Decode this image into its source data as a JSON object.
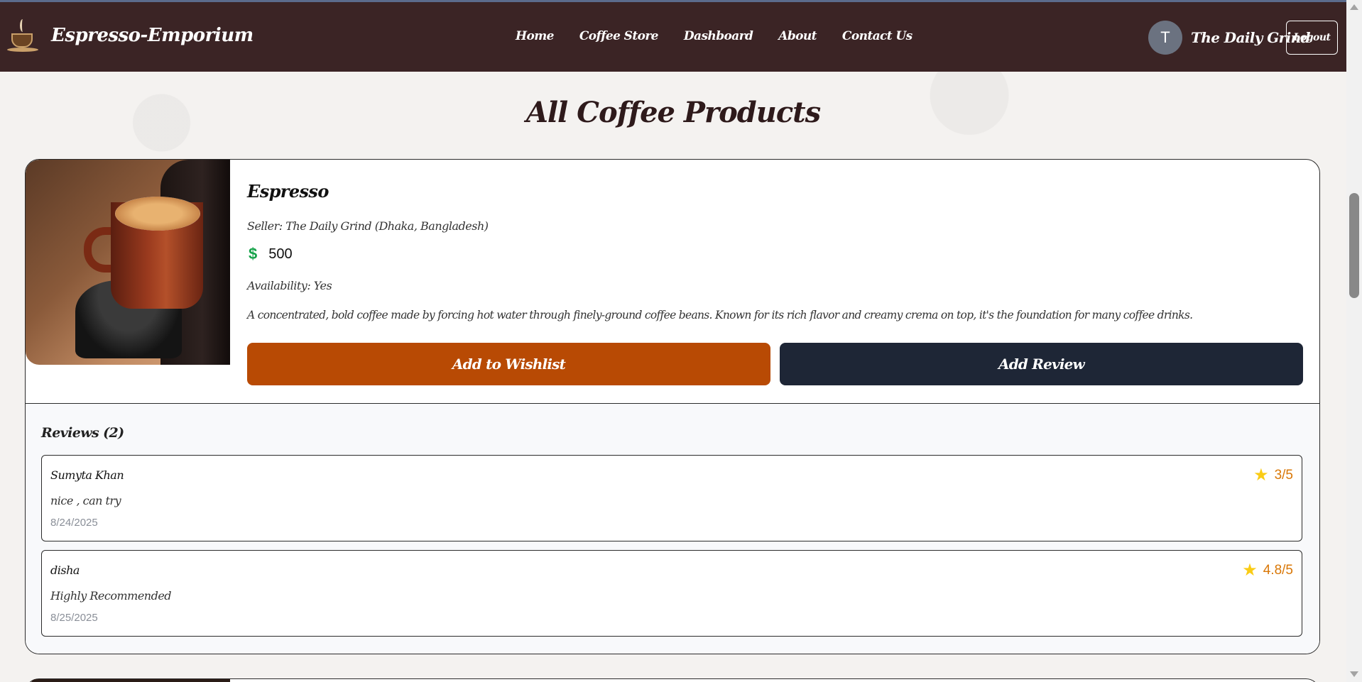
{
  "brand": {
    "name": "Espresso-Emporium"
  },
  "nav": {
    "links": [
      "Home",
      "Coffee Store",
      "Dashboard",
      "About",
      "Contact Us"
    ]
  },
  "user": {
    "initial": "T",
    "name": "The Daily Grind",
    "logout_label": "Logout"
  },
  "page": {
    "title": "All Coffee Products"
  },
  "product": {
    "name": "Espresso",
    "seller": "Seller: The Daily Grind (Dhaka, Bangladesh)",
    "currency_icon": "$",
    "price": "500",
    "availability": "Availability: Yes",
    "description": "A concentrated, bold coffee made by forcing hot water through finely-ground coffee beans. Known for its rich flavor and creamy crema on top, it's the foundation for many coffee drinks.",
    "wishlist_label": "Add to Wishlist",
    "review_label": "Add Review"
  },
  "reviews": {
    "title": "Reviews (2)",
    "items": [
      {
        "name": "Sumyta Khan",
        "text": "nice , can try",
        "date": "8/24/2025",
        "rating": "3/5"
      },
      {
        "name": "disha",
        "text": "Highly Recommended",
        "date": "8/25/2025",
        "rating": "4.8/5"
      }
    ]
  },
  "colors": {
    "navbar": "#3b2425",
    "wishlist_button": "#b84a04",
    "review_button": "#1e2636",
    "price_icon": "#16a34a",
    "star": "#facc15",
    "rating_text": "#d97706"
  }
}
